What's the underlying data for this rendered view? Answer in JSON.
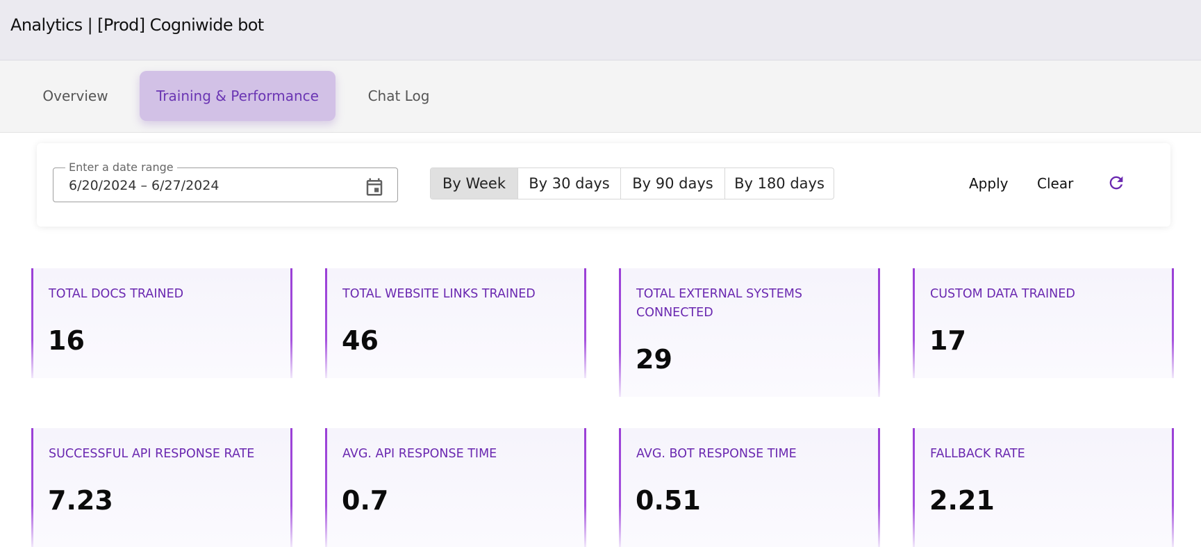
{
  "header": {
    "title": "Analytics | [Prod] Cogniwide bot"
  },
  "tabs": [
    {
      "label": "Overview",
      "active": false
    },
    {
      "label": "Training & Performance",
      "active": true
    },
    {
      "label": "Chat Log",
      "active": false
    }
  ],
  "filters": {
    "date_range_label": "Enter a date range",
    "date_range_value": "6/20/2024 – 6/27/2024",
    "periods": [
      "By Week",
      "By 30 days",
      "By 90 days",
      "By 180 days"
    ],
    "selected_period": "By Week",
    "apply_label": "Apply",
    "clear_label": "Clear",
    "calendar_icon": "calendar-icon",
    "refresh_icon": "refresh-icon"
  },
  "stats_row1": [
    {
      "label": "TOTAL DOCS TRAINED",
      "value": "16"
    },
    {
      "label": "TOTAL WEBSITE LINKS TRAINED",
      "value": "46"
    },
    {
      "label": "TOTAL EXTERNAL SYSTEMS CONNECTED",
      "value": "29"
    },
    {
      "label": "CUSTOM DATA TRAINED",
      "value": "17"
    }
  ],
  "stats_row2": [
    {
      "label": "SUCCESSFUL API RESPONSE RATE",
      "value": "7.23"
    },
    {
      "label": "AVG. API RESPONSE TIME",
      "value": "0.7"
    },
    {
      "label": "AVG. BOT RESPONSE TIME",
      "value": "0.51"
    },
    {
      "label": "FALLBACK RATE",
      "value": "2.21"
    }
  ],
  "colors": {
    "accent": "#6a28b0",
    "active_tab_bg": "#d2c1e6",
    "card_border": "#9a3fd6"
  }
}
